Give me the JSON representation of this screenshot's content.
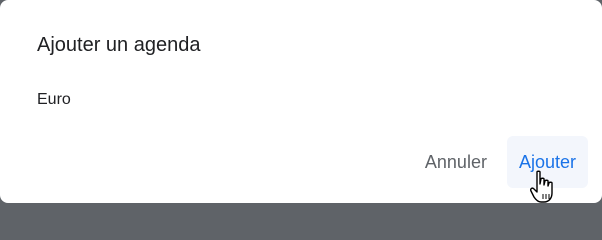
{
  "dialog": {
    "title": "Ajouter un agenda",
    "body": "Euro",
    "cancel_label": "Annuler",
    "confirm_label": "Ajouter"
  },
  "colors": {
    "accent": "#1a73e8",
    "text": "#202124",
    "secondary_text": "#5f6368",
    "hover_bg": "#f3f6fc"
  },
  "cursor": {
    "icon": "hand-pointer-icon"
  }
}
